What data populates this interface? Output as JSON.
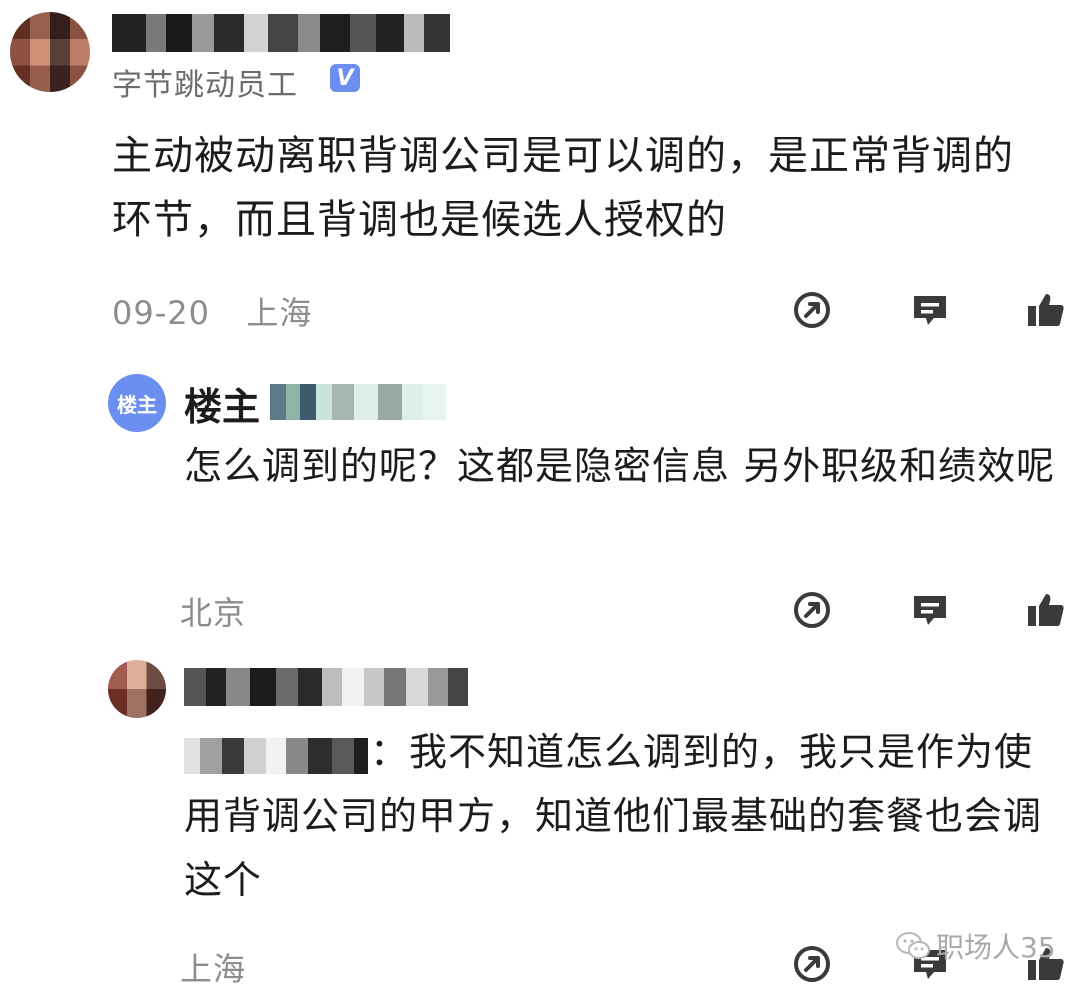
{
  "comment_main": {
    "user_badge": "字节跳动员工",
    "verified_label": "V",
    "text": "主动被动离职背调公司是可以调的，是正常背调的环节，而且背调也是候选人授权的",
    "date": "09-20",
    "location": "上海"
  },
  "reply_op": {
    "avatar_text": "楼主",
    "name": "楼主",
    "text": "怎么调到的呢？这都是隐密信息 另外职级和绩效呢",
    "location": "北京"
  },
  "reply_2": {
    "text": "：我不知道怎么调到的，我只是作为使用背调公司的甲方，知道他们最基础的套餐也会调这个",
    "location": "上海"
  },
  "icons": {
    "share": "share-icon",
    "comment": "comment-icon",
    "like": "thumbs-up-icon"
  },
  "watermark": {
    "text": "职场人35",
    "icon": "wechat-icon"
  },
  "colors": {
    "text": "#1c1c1c",
    "meta": "#8d8d8d",
    "accent": "#6d8ef0",
    "icon": "#3a3a3a"
  }
}
